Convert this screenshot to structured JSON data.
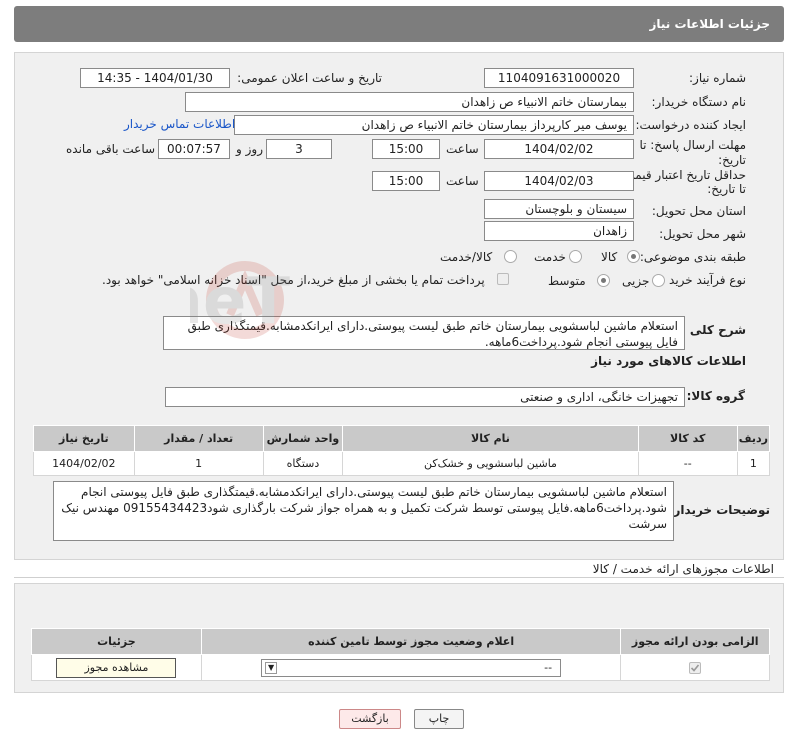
{
  "header": {
    "title": "جزئیات اطلاعات نیاز"
  },
  "form": {
    "need_number": {
      "label": "شماره نیاز:",
      "value": "1104091631000020"
    },
    "announce_datetime": {
      "label": "تاریخ و ساعت اعلان عمومی:",
      "value": "1404/01/30 - 14:35"
    },
    "buyer_org": {
      "label": "نام دستگاه خریدار:",
      "value": "بیمارستان خاتم الانبیاء  ص  زاهدان"
    },
    "requester": {
      "label": "ایجاد کننده درخواست:",
      "value": "یوسف میر کارپرداز بیمارستان خاتم الانبیاء  ص  زاهدان",
      "contact_link": "اطلاعات تماس خریدار"
    },
    "reply_deadline": {
      "label_line1": "مهلت ارسال پاسخ: تا",
      "label_line2": "تاریخ:",
      "date": "1404/02/02",
      "time_label": "ساعت",
      "time": "15:00",
      "days": "3",
      "days_label": "روز و",
      "remaining": "00:07:57",
      "remaining_label": "ساعت باقی مانده"
    },
    "price_validity": {
      "label_line1": "حداقل تاریخ اعتبار قیمت:",
      "label_line2": "تا تاریخ:",
      "date": "1404/02/03",
      "time_label": "ساعت",
      "time": "15:00"
    },
    "province": {
      "label": "استان محل تحویل:",
      "value": "سیستان و بلوچستان"
    },
    "city": {
      "label": "شهر محل تحویل:",
      "value": "زاهدان"
    },
    "category": {
      "label": "طبقه بندی موضوعی:",
      "options": [
        "کالا",
        "خدمت",
        "کالا/خدمت"
      ],
      "selected": "کالا"
    },
    "process": {
      "label": "نوع فرآیند خرید :",
      "options": [
        "جزیی",
        "متوسط"
      ],
      "selected": "متوسط",
      "treasury_note": "پرداخت تمام یا بخشی از مبلغ خرید،از محل \"اسناد خزانه اسلامی\" خواهد بود."
    },
    "description": {
      "label": "شرح کلی نیاز:",
      "value": "استعلام ماشین لباسشویی بیمارستان خاتم طبق لیست پیوستی.دارای ایرانکدمشابه.قیمتگذاری طبق فایل پیوستی انجام شود.پرداخت6ماهه."
    }
  },
  "goods_section": {
    "title": "اطلاعات کالاهای مورد نیاز",
    "group_label": "گروه کالا:",
    "group_value": "تجهیزات خانگی، اداری و صنعتی",
    "columns": [
      "ردیف",
      "کد کالا",
      "نام کالا",
      "واحد شمارش",
      "تعداد / مقدار",
      "تاریخ نیاز"
    ],
    "rows": [
      [
        "1",
        "--",
        "ماشین لباسشویی و خشک‌کن",
        "دستگاه",
        "1",
        "1404/02/02"
      ]
    ],
    "buyer_notes_label": "توضیحات خریدار:",
    "buyer_notes": "استعلام ماشین لباسشویی بیمارستان خاتم طبق لیست پیوستی.دارای ایرانکدمشابه.قیمتگذاری طبق فایل پیوستی انجام شود.پرداخت6ماهه.فایل پیوستی توسط شرکت تکمیل و به همراه جواز شرکت بارگذاری شود09155434423 مهندس نیک سرشت"
  },
  "license_section": {
    "title": "اطلاعات مجوزهای ارائه خدمت / کالا",
    "columns": [
      "الزامی بودن ارائه مجوز",
      "اعلام وضعیت مجوز توسط تامین کننده",
      "جزئیات"
    ],
    "select_value": "--",
    "view_button": "مشاهده مجوز"
  },
  "footer": {
    "print_button": "چاپ",
    "back_button": "بازگشت"
  },
  "watermark": {
    "text": "AriaTender.neT"
  }
}
